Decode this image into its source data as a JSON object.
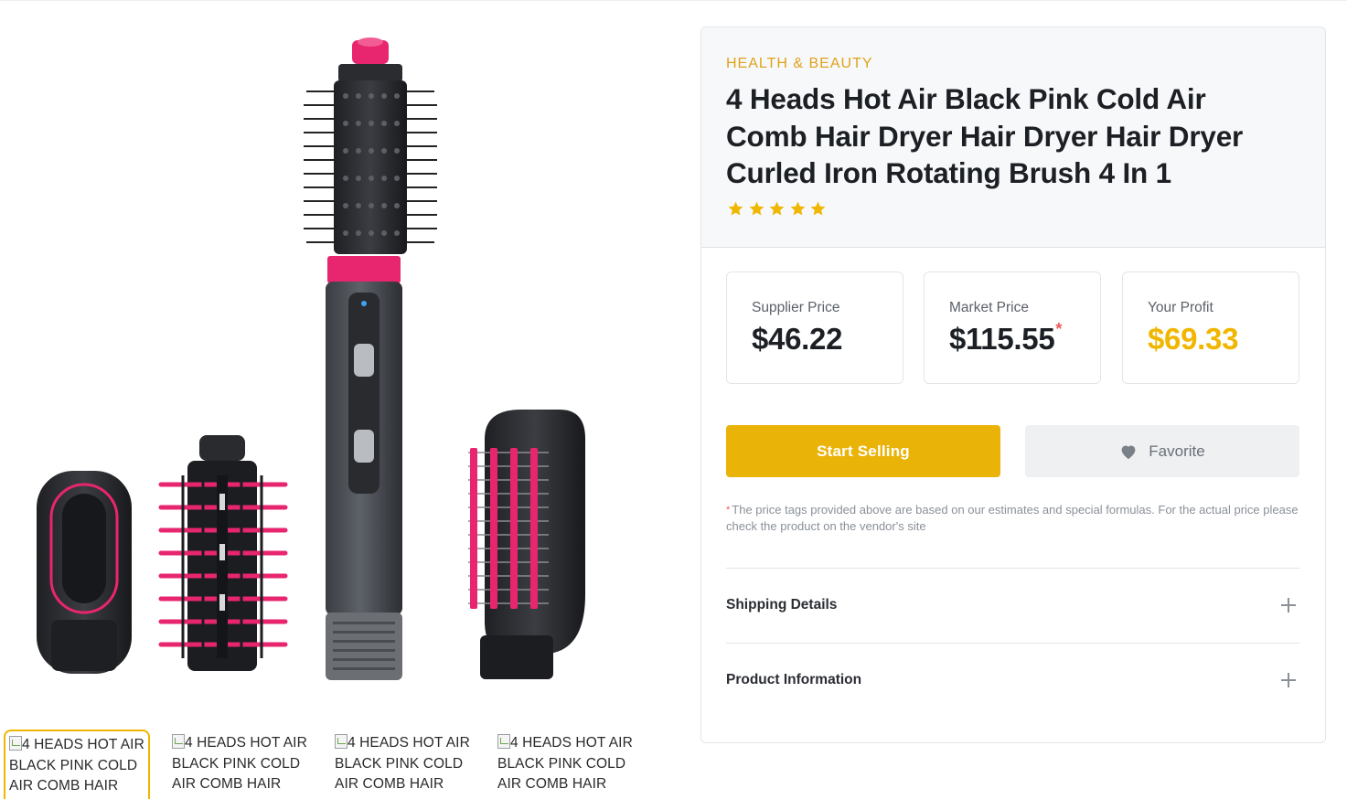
{
  "product": {
    "category": "HEALTH & BEAUTY",
    "title": "4 Heads Hot Air Black Pink Cold Air Comb Hair Dryer Hair Dryer Hair Dryer Curled Iron Rotating Brush 4 In 1",
    "rating_stars": 5,
    "rating_color": "#f0b600",
    "image_accent": "#e8256f"
  },
  "thumbnails": [
    {
      "alt": "4 HEADS HOT AIR BLACK PINK COLD AIR COMB HAIR"
    },
    {
      "alt": "4 HEADS HOT AIR BLACK PINK COLD AIR COMB HAIR"
    },
    {
      "alt": "4 HEADS HOT AIR BLACK PINK COLD AIR COMB HAIR"
    },
    {
      "alt": "4 HEADS HOT AIR BLACK PINK COLD AIR COMB HAIR"
    }
  ],
  "prices": {
    "supplier": {
      "label": "Supplier Price",
      "value": "$46.22"
    },
    "market": {
      "label": "Market Price",
      "value": "$115.55",
      "asterisk": "*"
    },
    "profit": {
      "label": "Your Profit",
      "value": "$69.33"
    }
  },
  "actions": {
    "start_selling": "Start Selling",
    "favorite": "Favorite",
    "favorite_icon": "heart-icon",
    "primary_color": "#eab308"
  },
  "disclaimer": {
    "asterisk": "*",
    "text": "The price tags provided above are based on our estimates and special formulas. For the actual price please check the product on the vendor's site"
  },
  "accordion": [
    {
      "label": "Shipping Details",
      "icon": "plus-icon"
    },
    {
      "label": "Product Information",
      "icon": "plus-icon"
    }
  ]
}
